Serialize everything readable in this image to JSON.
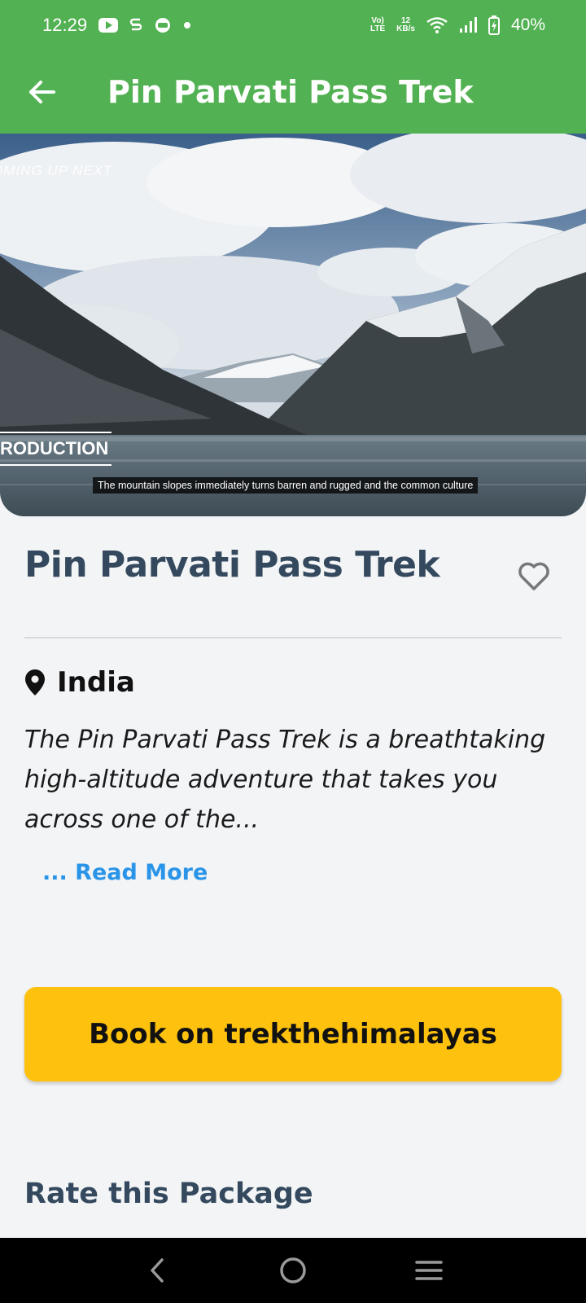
{
  "status_bar": {
    "time": "12:29",
    "net_top": "12",
    "net_bottom": "KB/s",
    "volte_top": "Vo)",
    "volte_bottom": "LTE",
    "battery": "40%"
  },
  "app_bar": {
    "title": "Pin Parvati Pass Trek"
  },
  "hero": {
    "overlay_coming": "OMING UP NEXT",
    "overlay_production": "RODUCTION",
    "caption": "The mountain slopes immediately turns barren and rugged and the common culture"
  },
  "package": {
    "title": "Pin Parvati Pass Trek",
    "location": "India",
    "description": "The Pin Parvati Pass Trek is a breathtaking high-altitude adventure that takes you across one of the...",
    "read_more": "... Read More",
    "book_label": "Book on trekthehimalayas",
    "rate_heading": "Rate this Package"
  },
  "colors": {
    "primary": "#52b152",
    "accent": "#fdc10e",
    "link": "#2a95e8",
    "heading": "#34495e"
  }
}
